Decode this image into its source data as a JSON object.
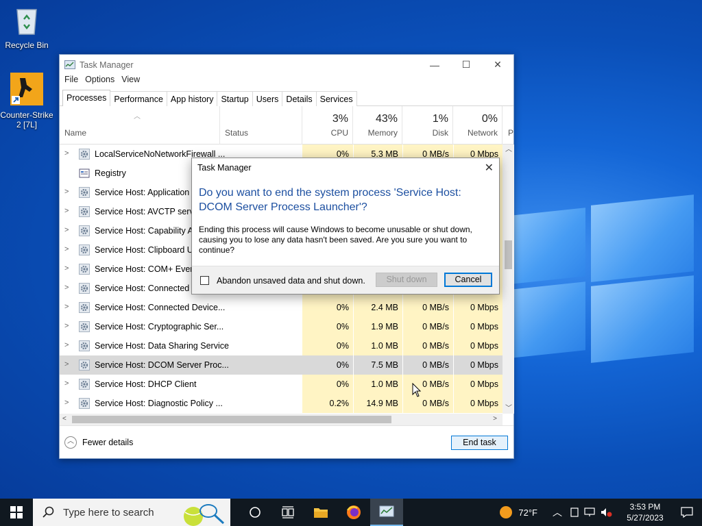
{
  "desktop": {
    "icons": [
      {
        "label": "Recycle Bin"
      },
      {
        "label": "Counter-Strike 2 [7L]"
      }
    ]
  },
  "window": {
    "title": "Task Manager",
    "menu": [
      "File",
      "Options",
      "View"
    ],
    "tabs": [
      "Processes",
      "Performance",
      "App history",
      "Startup",
      "Users",
      "Details",
      "Services"
    ],
    "active_tab": "Processes",
    "columns": {
      "name": "Name",
      "status": "Status",
      "cpu": {
        "pct": "3%",
        "label": "CPU"
      },
      "memory": {
        "pct": "43%",
        "label": "Memory"
      },
      "disk": {
        "pct": "1%",
        "label": "Disk"
      },
      "network": {
        "pct": "0%",
        "label": "Network"
      },
      "extra": "P"
    },
    "rows": [
      {
        "name": "LocalServiceNoNetworkFirewall ...",
        "cpu": "0%",
        "mem": "5.3 MB",
        "disk": "0 MB/s",
        "net": "0 Mbps",
        "expandable": true
      },
      {
        "name": "Registry",
        "cpu": "",
        "mem": "",
        "disk": "",
        "net": "",
        "expandable": false
      },
      {
        "name": "Service Host: Application Ir",
        "cpu": "",
        "mem": "",
        "disk": "",
        "net": "",
        "expandable": true
      },
      {
        "name": "Service Host: AVCTP service",
        "cpu": "",
        "mem": "",
        "disk": "",
        "net": "",
        "expandable": true
      },
      {
        "name": "Service Host: Capability Ac",
        "cpu": "",
        "mem": "",
        "disk": "",
        "net": "",
        "expandable": true
      },
      {
        "name": "Service Host: Clipboard Use",
        "cpu": "",
        "mem": "",
        "disk": "",
        "net": "",
        "expandable": true
      },
      {
        "name": "Service Host: COM+ Event",
        "cpu": "",
        "mem": "",
        "disk": "",
        "net": "",
        "expandable": true
      },
      {
        "name": "Service Host: Connected D",
        "cpu": "",
        "mem": "",
        "disk": "",
        "net": "",
        "expandable": true
      },
      {
        "name": "Service Host: Connected Device...",
        "cpu": "0%",
        "mem": "2.4 MB",
        "disk": "0 MB/s",
        "net": "0 Mbps",
        "expandable": true
      },
      {
        "name": "Service Host: Cryptographic Ser...",
        "cpu": "0%",
        "mem": "1.9 MB",
        "disk": "0 MB/s",
        "net": "0 Mbps",
        "expandable": true
      },
      {
        "name": "Service Host: Data Sharing Service",
        "cpu": "0%",
        "mem": "1.0 MB",
        "disk": "0 MB/s",
        "net": "0 Mbps",
        "expandable": true
      },
      {
        "name": "Service Host: DCOM Server Proc...",
        "cpu": "0%",
        "mem": "7.5 MB",
        "disk": "0 MB/s",
        "net": "0 Mbps",
        "expandable": true,
        "selected": true
      },
      {
        "name": "Service Host: DHCP Client",
        "cpu": "0%",
        "mem": "1.0 MB",
        "disk": "0 MB/s",
        "net": "0 Mbps",
        "expandable": true
      },
      {
        "name": "Service Host: Diagnostic Policy ...",
        "cpu": "0.2%",
        "mem": "14.9 MB",
        "disk": "0 MB/s",
        "net": "0 Mbps",
        "expandable": true
      }
    ],
    "footer": {
      "fewer_details": "Fewer details",
      "end_task": "End task"
    }
  },
  "dialog": {
    "title": "Task Manager",
    "heading": "Do you want to end the system process 'Service Host: DCOM Server Process Launcher'?",
    "body": "Ending this process will cause Windows to become unusable or shut down, causing you to lose any data hasn't been saved. Are you sure you want to continue?",
    "checkbox_label": "Abandon unsaved data and shut down.",
    "checkbox_checked": false,
    "shutdown_label": "Shut down",
    "cancel_label": "Cancel"
  },
  "taskbar": {
    "search_placeholder": "Type here to search",
    "weather": "72°F",
    "time": "3:53 PM",
    "date": "5/27/2023"
  }
}
